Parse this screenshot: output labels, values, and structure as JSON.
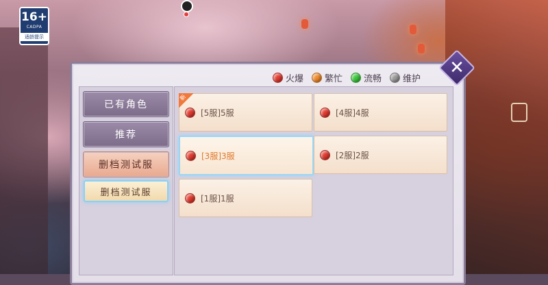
{
  "badge": {
    "age": "16+",
    "org": "CADPA",
    "tip": "适龄提示"
  },
  "legend": [
    {
      "label": "火爆",
      "color": "#e23a2f"
    },
    {
      "label": "繁忙",
      "color": "#f08a2c"
    },
    {
      "label": "流畅",
      "color": "#3cc83c"
    },
    {
      "label": "维护",
      "color": "#9a9a9a"
    }
  ],
  "categories": {
    "owned": "已有角色",
    "recommend": "推荐",
    "test_group": "删档测试服",
    "test_sub": "删档测试服"
  },
  "servers": [
    {
      "name": "[5服]5服",
      "status_color": "#e23a2f",
      "tag": "新"
    },
    {
      "name": "[4服]4服",
      "status_color": "#e23a2f"
    },
    {
      "name": "[3服]3服",
      "status_color": "#e23a2f",
      "selected": true
    },
    {
      "name": "[2服]2服",
      "status_color": "#e23a2f"
    },
    {
      "name": "[1服]1服",
      "status_color": "#e23a2f"
    }
  ],
  "close_label": "✕"
}
